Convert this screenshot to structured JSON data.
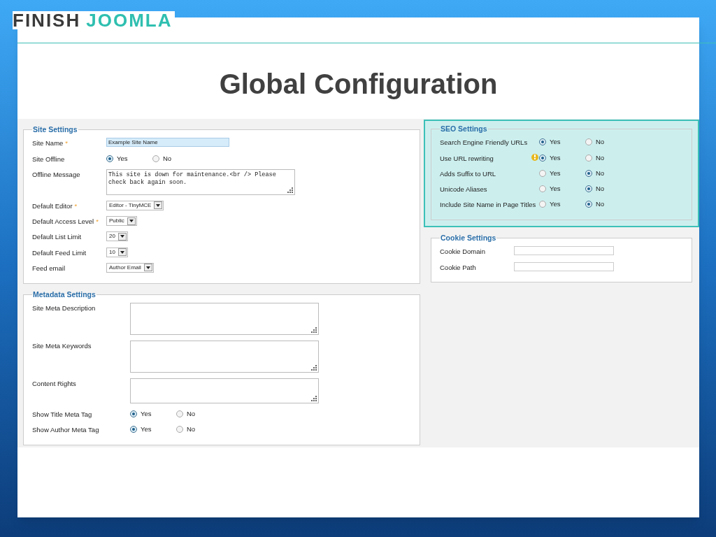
{
  "logo": {
    "part_1": "FINISH",
    "part_2": "JOOMLA"
  },
  "title": "Global Configuration",
  "columns": [
    {
      "sections": [
        {
          "legend": "Site Settings",
          "highlighted": false,
          "fields": [
            {
              "kind": "text",
              "label": "Site Name",
              "required_mark": "*",
              "value": "Example Site Name"
            },
            {
              "kind": "radio",
              "label": "Site Offline",
              "options": [
                {
                  "label": "Yes",
                  "selected": true
                },
                {
                  "label": "No",
                  "selected": false
                }
              ]
            },
            {
              "kind": "textarea",
              "label": "Offline Message",
              "value": "This site is down for maintenance.<br /> Please check back again soon."
            },
            {
              "kind": "select",
              "label": "Default Editor",
              "required_mark": "*",
              "value": "Editor - TinyMCE"
            },
            {
              "kind": "select",
              "label": "Default Access Level",
              "required_mark": "*",
              "value": "Public"
            },
            {
              "kind": "select",
              "label": "Default List Limit",
              "value": "20"
            },
            {
              "kind": "select",
              "label": "Default Feed Limit",
              "value": "10"
            },
            {
              "kind": "select",
              "label": "Feed email",
              "value": "Author Email"
            }
          ]
        },
        {
          "legend": "Metadata Settings",
          "highlighted": false,
          "fields": [
            {
              "kind": "textarea",
              "label": "Site Meta Description"
            },
            {
              "kind": "textarea",
              "label": "Site Meta Keywords"
            },
            {
              "kind": "textarea",
              "label": "Content Rights"
            },
            {
              "kind": "radio",
              "label": "Show Title Meta Tag",
              "options": [
                {
                  "label": "Yes",
                  "selected": true
                },
                {
                  "label": "No",
                  "selected": false
                }
              ]
            },
            {
              "kind": "radio",
              "label": "Show Author Meta Tag",
              "options": [
                {
                  "label": "Yes",
                  "selected": true
                },
                {
                  "label": "No",
                  "selected": false
                }
              ]
            }
          ]
        }
      ]
    },
    {
      "sections": [
        {
          "legend": "SEO Settings",
          "highlighted": true,
          "fields": [
            {
              "kind": "radio",
              "label": "Search Engine Friendly URLs",
              "warning": false,
              "options": [
                {
                  "label": "Yes",
                  "selected": true
                },
                {
                  "label": "No",
                  "selected": false
                }
              ]
            },
            {
              "kind": "radio",
              "label": "Use URL rewriting",
              "warning": true,
              "options": [
                {
                  "label": "Yes",
                  "selected": true
                },
                {
                  "label": "No",
                  "selected": false
                }
              ]
            },
            {
              "kind": "radio",
              "label": "Adds Suffix to URL",
              "warning": false,
              "options": [
                {
                  "label": "Yes",
                  "selected": false
                },
                {
                  "label": "No",
                  "selected": true
                }
              ]
            },
            {
              "kind": "radio",
              "label": "Unicode Aliases",
              "warning": false,
              "options": [
                {
                  "label": "Yes",
                  "selected": false
                },
                {
                  "label": "No",
                  "selected": true
                }
              ]
            },
            {
              "kind": "radio",
              "label": "Include Site Name in Page Titles",
              "warning": false,
              "options": [
                {
                  "label": "Yes",
                  "selected": false
                },
                {
                  "label": "No",
                  "selected": true
                }
              ]
            }
          ]
        },
        {
          "legend": "Cookie Settings",
          "highlighted": false,
          "fields": [
            {
              "kind": "text",
              "label": "Cookie Domain"
            },
            {
              "kind": "text",
              "label": "Cookie Path"
            }
          ]
        }
      ]
    }
  ]
}
